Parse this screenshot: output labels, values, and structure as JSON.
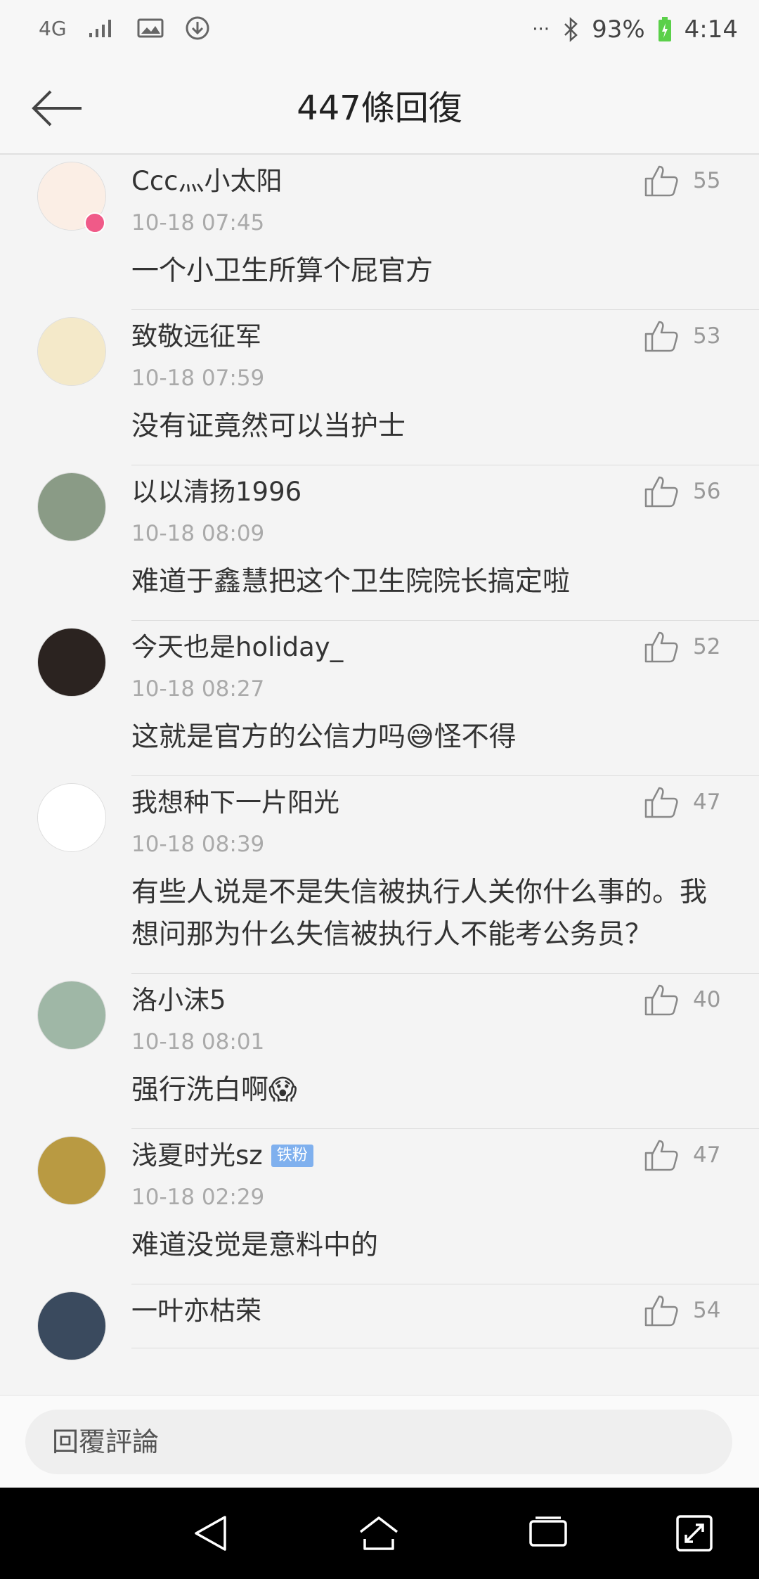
{
  "status_bar": {
    "network": "4G",
    "battery": "93%",
    "time": "4:14",
    "more": "···"
  },
  "header": {
    "title": "447條回復"
  },
  "comments": [
    {
      "user": "Ccc灬小太阳",
      "time": "10-18 07:45",
      "text": "一个小卫生所算个屁官方",
      "likes": "55",
      "avatar_color": "#fbeee5",
      "verified": true
    },
    {
      "user": "致敬远征军",
      "time": "10-18 07:59",
      "text": "没有证竟然可以当护士",
      "likes": "53",
      "avatar_color": "#f4e9c9"
    },
    {
      "user": "以以清扬1996",
      "time": "10-18 08:09",
      "text": "难道于鑫慧把这个卫生院院长搞定啦",
      "likes": "56",
      "avatar_color": "#8a9b86"
    },
    {
      "user": "今天也是holiday_",
      "time": "10-18 08:27",
      "text": "这就是官方的公信力吗😅怪不得",
      "likes": "52",
      "avatar_color": "#2b2320"
    },
    {
      "user": "我想种下一片阳光",
      "time": "10-18 08:39",
      "text": "有些人说是不是失信被执行人关你什么事的。我想问那为什么失信被执行人不能考公务员？",
      "likes": "47",
      "avatar_color": "#ffffff"
    },
    {
      "user": "洛小沫5",
      "time": "10-18 08:01",
      "text": "强行洗白啊😱",
      "likes": "40",
      "avatar_color": "#9fb7a6"
    },
    {
      "user": "浅夏时光sz",
      "badge": "铁粉",
      "time": "10-18 02:29",
      "text": "难道没觉是意料中的",
      "likes": "47",
      "avatar_color": "#b99a42"
    },
    {
      "user": "一叶亦枯荣",
      "time": "",
      "text": "",
      "likes": "54",
      "avatar_color": "#3a4a5e"
    }
  ],
  "reply_bar": {
    "placeholder": "回覆評論"
  },
  "icons": {
    "back": "arrow-left-icon",
    "like": "thumbs-up-icon",
    "nav_back": "triangle-back-icon",
    "nav_home": "home-icon",
    "nav_recent": "recent-apps-icon",
    "nav_expand": "expand-icon"
  },
  "colors": {
    "battery_fill": "#5bd04a",
    "verified_badge": "#f05a88",
    "fan_badge": "#7fb0ee"
  }
}
